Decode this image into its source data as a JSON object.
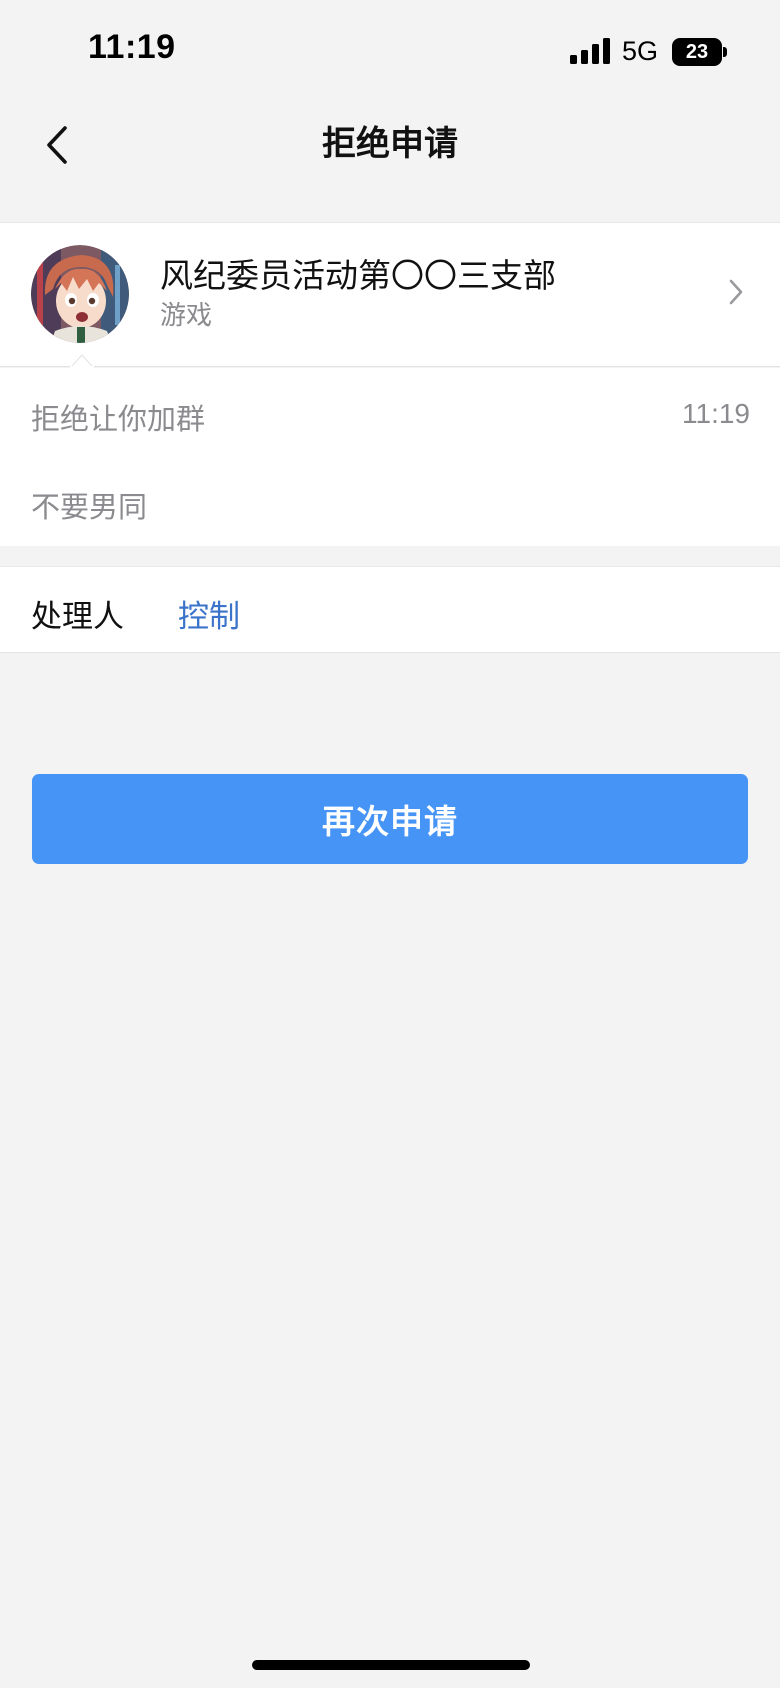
{
  "status_bar": {
    "time": "11:19",
    "network": "5G",
    "battery_level": "23",
    "icons": [
      "signal-bars-icon",
      "battery-icon"
    ]
  },
  "nav": {
    "title": "拒绝申请",
    "back_icon": "chevron-left-icon"
  },
  "group": {
    "name": "风纪委员活动第〇〇三支部",
    "category": "游戏",
    "avatar_icon": "anime-avatar"
  },
  "message": {
    "title": "拒绝让你加群",
    "time": "11:19",
    "body": "不要男同"
  },
  "handler": {
    "label": "处理人",
    "name": "控制"
  },
  "actions": {
    "reapply_label": "再次申请"
  },
  "colors": {
    "accent": "#4594f6",
    "link": "#3a73c9",
    "secondary_text": "#8b8b8f",
    "background": "#f3f3f4"
  }
}
